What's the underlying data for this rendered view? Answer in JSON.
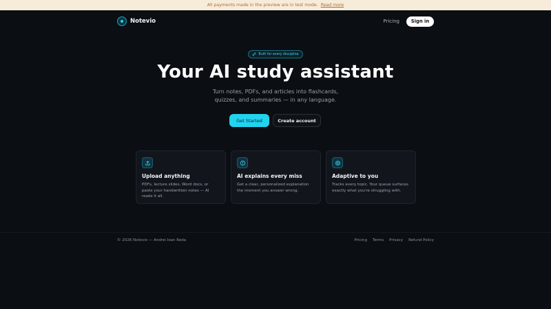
{
  "banner": {
    "text": "All payments made in the preview are in test mode.",
    "link": "Read more"
  },
  "nav": {
    "brand": "Notevio",
    "pricing": "Pricing",
    "signin": "Sign in"
  },
  "hero": {
    "pill": "Built for every discipline",
    "title": "Your AI study assistant",
    "subtitle_line1": "Turn notes, PDFs, and articles into flashcards,",
    "subtitle_line2": "quizzes, and summaries — in any language.",
    "cta_primary": "Get Started",
    "cta_secondary": "Create account"
  },
  "features": [
    {
      "icon": "upload-icon",
      "title": "Upload anything",
      "body": "PDFs, lecture slides, Word docs, or paste your handwritten notes — AI reads it all."
    },
    {
      "icon": "info-icon",
      "title": "AI explains every miss",
      "body": "Get a clear, personalized explanation the moment you answer wrong."
    },
    {
      "icon": "target-icon",
      "title": "Adaptive to you",
      "body": "Tracks every topic. Your queue surfaces exactly what you're struggling with."
    }
  ],
  "footer": {
    "copyright": "© 2026 Notevio — Andrei Ioan Reda",
    "links": [
      "Pricing",
      "Terms",
      "Privacy",
      "Refund Policy"
    ]
  },
  "colors": {
    "accent": "#22d3ee",
    "background": "#0b0e12",
    "banner_bg": "#f6ecd9"
  }
}
